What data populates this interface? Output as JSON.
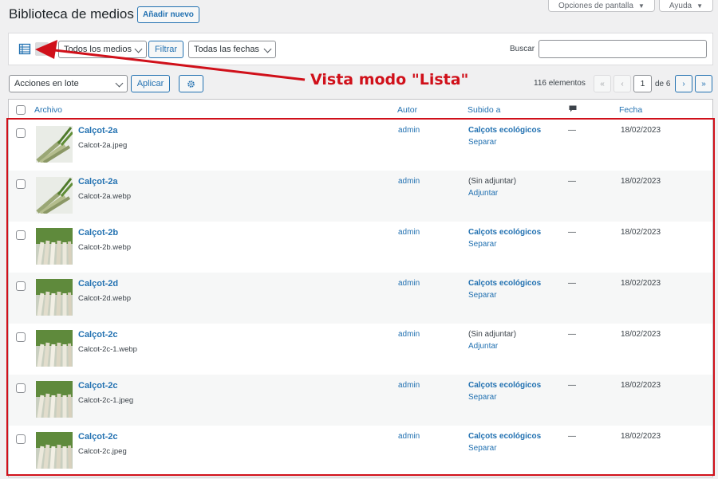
{
  "header": {
    "title": "Biblioteca de medios",
    "add_new": "Añadir nuevo",
    "screen_options": "Opciones de pantalla",
    "help": "Ayuda"
  },
  "filters": {
    "media_type": "Todos los medios",
    "filter_button": "Filtrar",
    "dates": "Todas las fechas",
    "search_label": "Buscar",
    "search_value": ""
  },
  "bulk": {
    "actions": "Acciones en lote",
    "apply": "Aplicar"
  },
  "pagination": {
    "count": "116 elementos",
    "first": "«",
    "prev": "‹",
    "current": "1",
    "of_text": "de 6",
    "next": "›",
    "last": "»"
  },
  "columns": {
    "file": "Archivo",
    "author": "Autor",
    "uploaded_to": "Subido a",
    "date": "Fecha"
  },
  "rows": [
    {
      "title": "Calçot-2a",
      "file": "Calcot-2a.jpeg",
      "author": "admin",
      "uploaded": "Calçots ecológicos",
      "action": "Separar",
      "comments": "—",
      "date": "18/02/2023"
    },
    {
      "title": "Calçot-2a",
      "file": "Calcot-2a.webp",
      "author": "admin",
      "uploaded": "(Sin adjuntar)",
      "action": "Adjuntar",
      "comments": "—",
      "date": "18/02/2023"
    },
    {
      "title": "Calçot-2b",
      "file": "Calcot-2b.webp",
      "author": "admin",
      "uploaded": "Calçots ecológicos",
      "action": "Separar",
      "comments": "—",
      "date": "18/02/2023"
    },
    {
      "title": "Calçot-2d",
      "file": "Calcot-2d.webp",
      "author": "admin",
      "uploaded": "Calçots ecológicos",
      "action": "Separar",
      "comments": "—",
      "date": "18/02/2023"
    },
    {
      "title": "Calçot-2c",
      "file": "Calcot-2c-1.webp",
      "author": "admin",
      "uploaded": "(Sin adjuntar)",
      "action": "Adjuntar",
      "comments": "—",
      "date": "18/02/2023"
    },
    {
      "title": "Calçot-2c",
      "file": "Calcot-2c-1.jpeg",
      "author": "admin",
      "uploaded": "Calçots ecológicos",
      "action": "Separar",
      "comments": "—",
      "date": "18/02/2023"
    },
    {
      "title": "Calçot-2c",
      "file": "Calcot-2c.jpeg",
      "author": "admin",
      "uploaded": "Calçots ecológicos",
      "action": "Separar",
      "comments": "—",
      "date": "18/02/2023"
    }
  ],
  "annotation": {
    "label": "Vista modo \"Lista\"",
    "color": "#d0101a"
  },
  "colors": {
    "link": "#2271b1",
    "accent_red": "#d0101a"
  }
}
